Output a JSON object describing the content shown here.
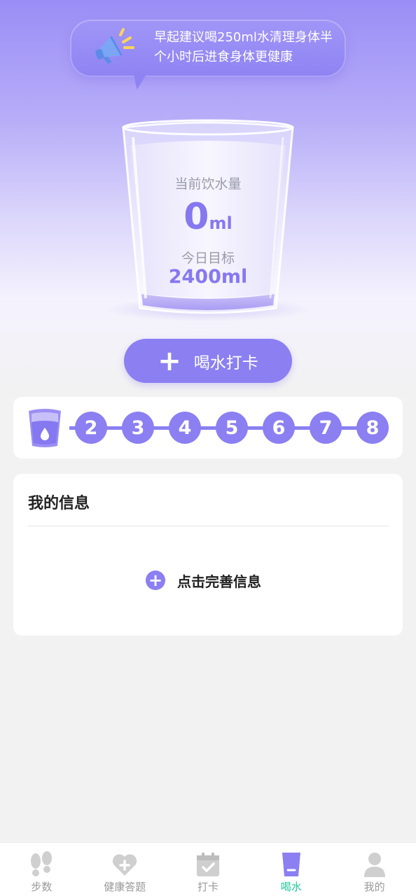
{
  "tip": {
    "line1": "早起建议喝250ml水清理身体半",
    "line2": "个小时后进食身体更健康",
    "icon": "megaphone-icon"
  },
  "glass": {
    "current_label": "当前饮水量",
    "current_value": "0",
    "current_unit": "ml",
    "target_label": "今日目标",
    "target_value": "2400ml"
  },
  "drink_button": {
    "icon": "plus-icon",
    "label": "喝水打卡"
  },
  "progress": {
    "first_icon": "water-cup-icon",
    "steps": [
      "2",
      "3",
      "4",
      "5",
      "6",
      "7",
      "8"
    ]
  },
  "info": {
    "title": "我的信息",
    "action_label": "点击完善信息",
    "action_icon": "plus-circle-icon"
  },
  "tabs": [
    {
      "label": "步数",
      "icon": "footprints-icon",
      "active": false
    },
    {
      "label": "健康答题",
      "icon": "heart-plus-icon",
      "active": false
    },
    {
      "label": "打卡",
      "icon": "calendar-check-icon",
      "active": false
    },
    {
      "label": "喝水",
      "icon": "water-cup-icon",
      "active": true
    },
    {
      "label": "我的",
      "icon": "user-icon",
      "active": false
    }
  ],
  "colors": {
    "accent": "#8b7ff2",
    "active_tab": "#1fc99a",
    "inactive_tab": "#999999"
  }
}
